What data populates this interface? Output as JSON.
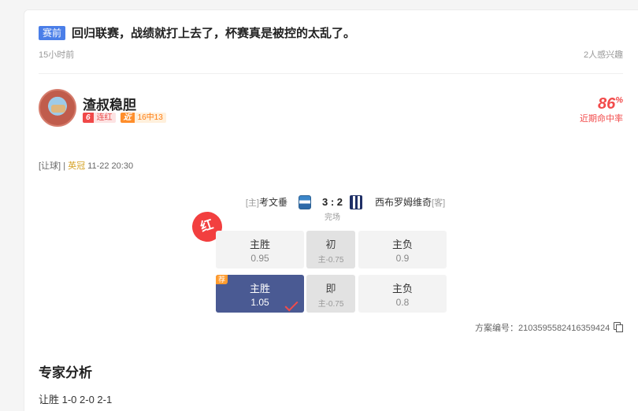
{
  "post": {
    "tag": "赛前",
    "headline": "回归联赛，战绩就打上去了，杯赛真是被控的太乱了。",
    "time": "15小时前",
    "interest": "2人感兴趣"
  },
  "expert": {
    "name": "渣叔稳胆",
    "badges": [
      {
        "key": "6",
        "value": "连红",
        "color": "#f04848"
      },
      {
        "key": "近",
        "value": "16中13",
        "color": "#ff8e2b"
      }
    ],
    "hit_rate_value": "86",
    "hit_rate_unit": "%",
    "hit_rate_label": "近期命中率"
  },
  "game": {
    "type": "[让球]",
    "separator": "|",
    "league": "英冠",
    "datetime": "11-22 20:30",
    "home_tag": "[主]",
    "home": "考文垂",
    "score": "3 : 2",
    "status": "完场",
    "away": "西布罗姆维奇",
    "away_tag": "[客]"
  },
  "result_seal": "红",
  "odds": {
    "rows": [
      {
        "left": {
          "label": "主胜",
          "odds": "0.95"
        },
        "middle": {
          "label": "初",
          "line": "主-0.75"
        },
        "right": {
          "label": "主负",
          "odds": "0.9"
        },
        "selected": false
      },
      {
        "left": {
          "label": "主胜",
          "odds": "1.05"
        },
        "middle": {
          "label": "即",
          "line": "主-0.75"
        },
        "right": {
          "label": "主负",
          "odds": "0.8"
        },
        "selected": true,
        "rec_tag": "荐"
      }
    ]
  },
  "plan": {
    "text": "方案编号：2103595582416359424",
    "icon": "copy-icon"
  },
  "analysis": {
    "title": "专家分析",
    "content": "让胜 1-0 2-0 2-1"
  },
  "colors": {
    "accent": "#4a7ee8",
    "red": "#f24b4b",
    "selected": "#4a5a93",
    "badge_orange": "#ff8e2b"
  }
}
